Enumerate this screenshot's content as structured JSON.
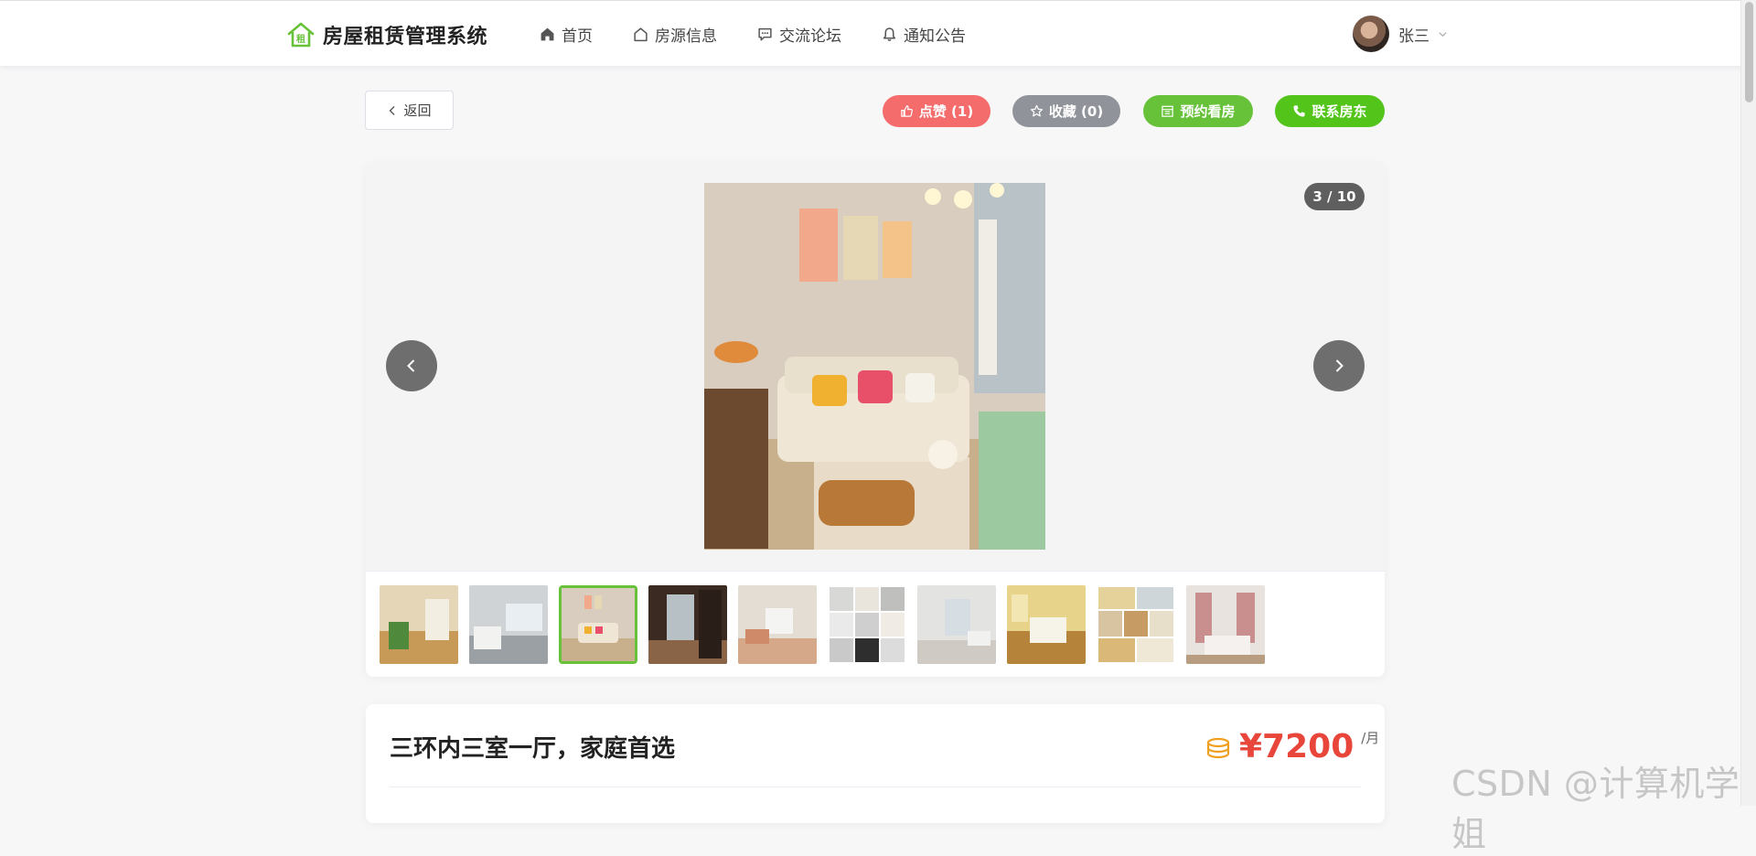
{
  "header": {
    "logo_text": "房屋租赁管理系统",
    "logo_badge": "租",
    "nav": [
      {
        "label": "首页",
        "icon": "home-icon"
      },
      {
        "label": "房源信息",
        "icon": "house-icon"
      },
      {
        "label": "交流论坛",
        "icon": "chat-icon"
      },
      {
        "label": "通知公告",
        "icon": "bell-icon"
      }
    ],
    "user": {
      "name": "张三"
    }
  },
  "actions": {
    "back_label": "返回",
    "like_label": "点赞 (1)",
    "favorite_label": "收藏 (0)",
    "book_label": "预约看房",
    "contact_label": "联系房东"
  },
  "gallery": {
    "counter": "3 / 10",
    "current_index": 3,
    "total": 10
  },
  "listing": {
    "title": "三环内三室一厅，家庭首选",
    "price": "¥7200",
    "price_unit": "/月"
  },
  "watermark": "CSDN @计算机学姐",
  "colors": {
    "brand": "#67c23a",
    "like": "#f56c6c",
    "favorite": "#909399",
    "book": "#67c23a",
    "contact": "#52c41a",
    "price": "#e8463a",
    "coin": "#f0a020"
  }
}
